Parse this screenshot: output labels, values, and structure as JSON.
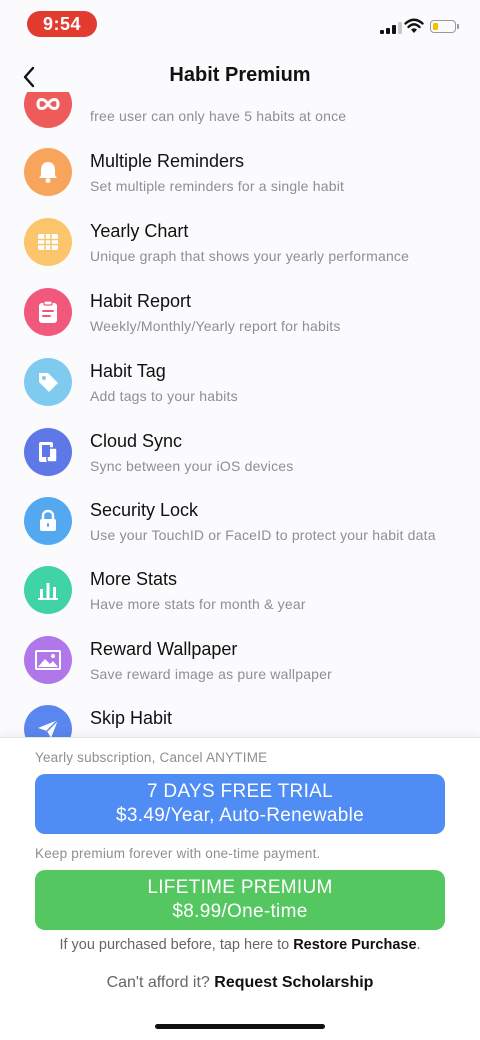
{
  "status_bar": {
    "time": "9:54"
  },
  "nav": {
    "title": "Habit Premium"
  },
  "features": [
    {
      "title": "",
      "desc": "free user can only have 5 habits at once",
      "icon": "infinity-icon",
      "color": "#ef5a5a"
    },
    {
      "title": "Multiple Reminders",
      "desc": "Set multiple reminders for a single habit",
      "icon": "bell-icon",
      "color": "#f7a45d"
    },
    {
      "title": "Yearly Chart",
      "desc": "Unique graph that shows your yearly performance",
      "icon": "calendar-grid-icon",
      "color": "#fbc66b"
    },
    {
      "title": "Habit Report",
      "desc": "Weekly/Monthly/Yearly report for habits",
      "icon": "clipboard-icon",
      "color": "#f2587b"
    },
    {
      "title": "Habit Tag",
      "desc": "Add tags to your habits",
      "icon": "tag-icon",
      "color": "#7fcbf0"
    },
    {
      "title": "Cloud Sync",
      "desc": "Sync between your iOS devices",
      "icon": "devices-icon",
      "color": "#5f78e8"
    },
    {
      "title": "Security Lock",
      "desc": "Use your TouchID or FaceID to protect your habit data",
      "icon": "lock-icon",
      "color": "#54a8f0"
    },
    {
      "title": "More Stats",
      "desc": "Have more stats for month & year",
      "icon": "bar-chart-icon",
      "color": "#3fd3a6"
    },
    {
      "title": "Reward Wallpaper",
      "desc": "Save reward image as pure wallpaper",
      "icon": "image-icon",
      "color": "#b077ea"
    },
    {
      "title": "Skip Habit",
      "desc": "",
      "icon": "paper-plane-icon",
      "color": "#5a86ef"
    }
  ],
  "purchase": {
    "subscription_note": "Yearly subscription, Cancel ANYTIME",
    "trial_line1": "7 DAYS FREE TRIAL",
    "trial_line2": "$3.49/Year, Auto-Renewable",
    "onetime_note": "Keep premium forever with one-time payment.",
    "lifetime_line1": "LIFETIME PREMIUM",
    "lifetime_line2": "$8.99/One-time",
    "restore_prefix": "If you purchased before, tap here to ",
    "restore_link": "Restore Purchase",
    "restore_suffix": ".",
    "scholarship_prefix": "Can't afford it? ",
    "scholarship_link": "Request Scholarship"
  }
}
